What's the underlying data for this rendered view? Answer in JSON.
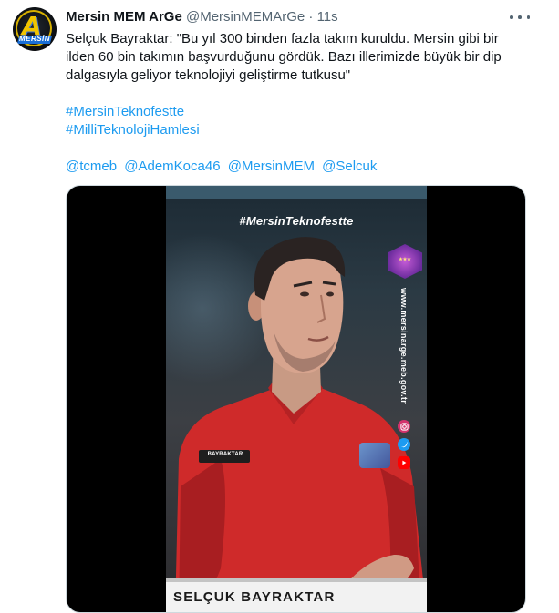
{
  "tweet": {
    "author_name": "Mersin MEM ArGe",
    "handle": "@MersinMEMArGe",
    "separator": "·",
    "time": "11s",
    "text_lines": [
      "Selçuk Bayraktar: \"Bu yıl 300 binden fazla takım kuruldu. Mersin gibi bir",
      "ilden 60 bin takımın başvurduğunu gördük. Bazı illerimizde büyük bir dip",
      "dalgasıyla geliyor teknolojiyi geliştirme tutkusu\""
    ],
    "hashtags": [
      "#MersinTeknofestte",
      "#MilliTeknolojiHamlesi"
    ],
    "mentions": [
      "@tcmeb",
      "@AdemKoca46",
      "@MersinMEM",
      "@Selcuk"
    ]
  },
  "avatar": {
    "letter": "A",
    "label": "MERSİN"
  },
  "video": {
    "overlay_hashtag": "#MersinTeknofestte",
    "side_url": "www.mersinarge.meb.gov.tr",
    "patch_text": "BAYRAKTAR",
    "lower_third_name": "SELÇUK BAYRAKTAR",
    "social_icons": [
      "instagram-icon",
      "twitter-icon",
      "youtube-icon"
    ]
  },
  "colors": {
    "link": "#1d9bf0",
    "secondary_text": "#536471",
    "jacket_red": "#d3282a"
  }
}
